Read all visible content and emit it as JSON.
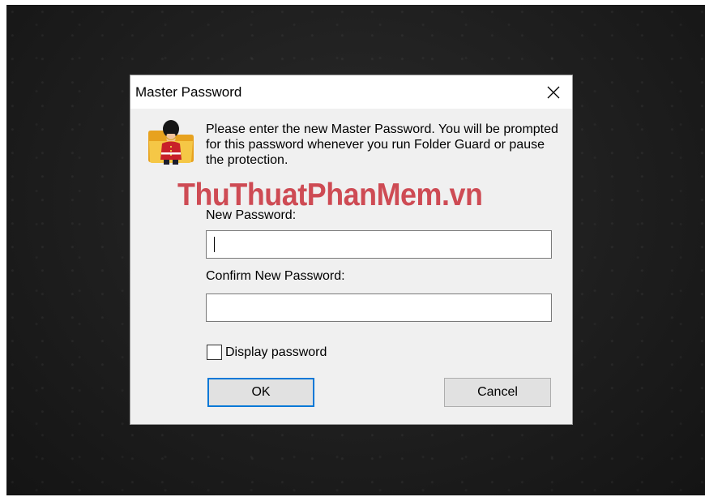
{
  "dialog": {
    "title": "Master Password",
    "close_glyph": "✕",
    "message": "Please enter the new Master Password. You will be prompted for this password whenever you run Folder Guard or pause the protection.",
    "watermark": "ThuThuatPhanMem.vn",
    "new_password_label": "New Password:",
    "new_password_value": "",
    "confirm_password_label": "Confirm New Password:",
    "confirm_password_value": "",
    "display_password_label": "Display password",
    "display_password_checked": false,
    "ok_label": "OK",
    "cancel_label": "Cancel"
  },
  "icons": {
    "app_icon": "folder-guard-guardsman-icon",
    "close_icon": "close-icon"
  },
  "colors": {
    "accent": "#0078d7",
    "watermark": "#c41c28",
    "dialog_background": "#f0f0f0"
  }
}
